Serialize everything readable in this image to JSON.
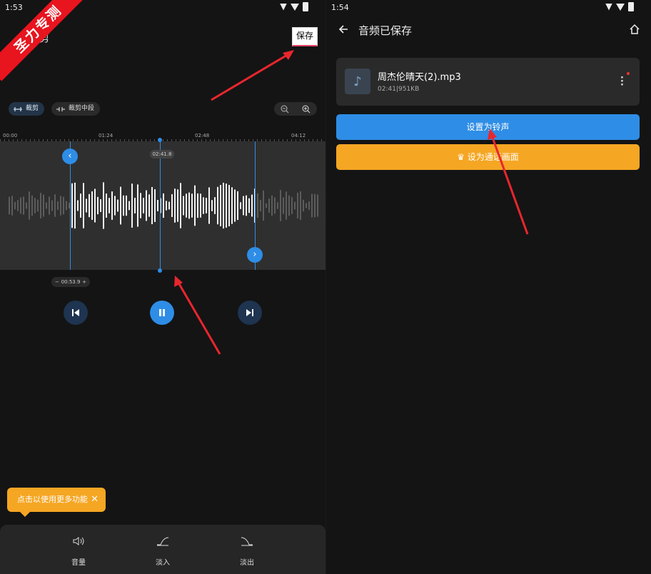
{
  "left": {
    "status_time": "1:53",
    "watermark": "圣力专测",
    "title_partial": "剪",
    "save_label": "保存",
    "mode_chips": [
      "裁剪",
      "裁剪中段"
    ],
    "ruler_labels": [
      "00:00",
      "01:24",
      "02:48",
      "04:12"
    ],
    "playhead_time": "02:41.8",
    "stepper": {
      "minus": "−",
      "value": "00:53.9",
      "plus": "+"
    },
    "tooltip": "点击以使用更多功能",
    "tools": [
      "音量",
      "淡入",
      "淡出"
    ]
  },
  "right": {
    "status_time": "1:54",
    "title": "音频已保存",
    "file_name": "周杰伦晴天(2).mp3",
    "file_duration": "02:41",
    "file_size": "951KB",
    "btn_ringtone": "设置为铃声",
    "btn_call_screen": "设为通话画面"
  },
  "colors": {
    "accent": "#2e8de6",
    "orange": "#f5a623",
    "watermark": "#e8141e",
    "annotation_arrow": "#e8262e"
  }
}
